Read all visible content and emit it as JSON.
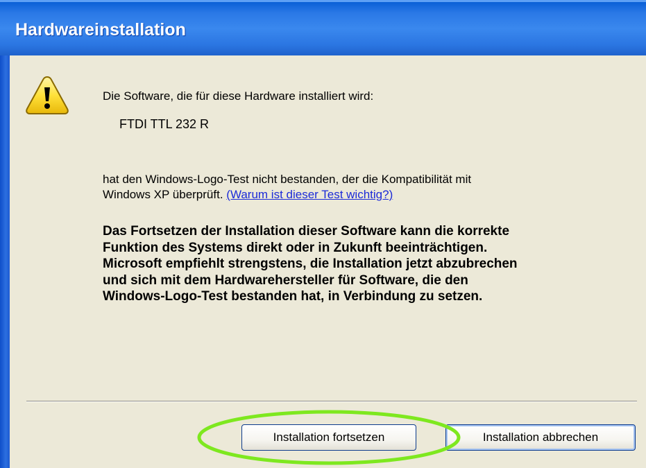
{
  "window": {
    "title": "Hardwareinstallation"
  },
  "dialog": {
    "intro": "Die Software, die für diese Hardware installiert wird:",
    "device_name": "FTDI TTL 232 R",
    "body_line1": "hat den Windows-Logo-Test nicht bestanden, der die Kompatibilität mit",
    "body_line2": "Windows XP überprüft. ",
    "link_text": "(Warum ist dieser Test wichtig?)",
    "warning_lines": [
      "Das Fortsetzen der Installation dieser Software kann die korrekte",
      "Funktion des Systems direkt oder in Zukunft beeinträchtigen.",
      "Microsoft empfiehlt strengstens, die Installation jetzt abzubrechen",
      "und sich mit dem Hardwarehersteller für Software, die den",
      "Windows-Logo-Test bestanden hat, in Verbindung zu setzen."
    ]
  },
  "buttons": {
    "continue": "Installation fortsetzen",
    "cancel": "Installation abbrechen"
  },
  "colors": {
    "titlebar": "#2a78e6",
    "link": "#1c2bd8",
    "highlight_ellipse": "#7ee81f"
  },
  "icons": {
    "warning": "warning-triangle-icon"
  }
}
